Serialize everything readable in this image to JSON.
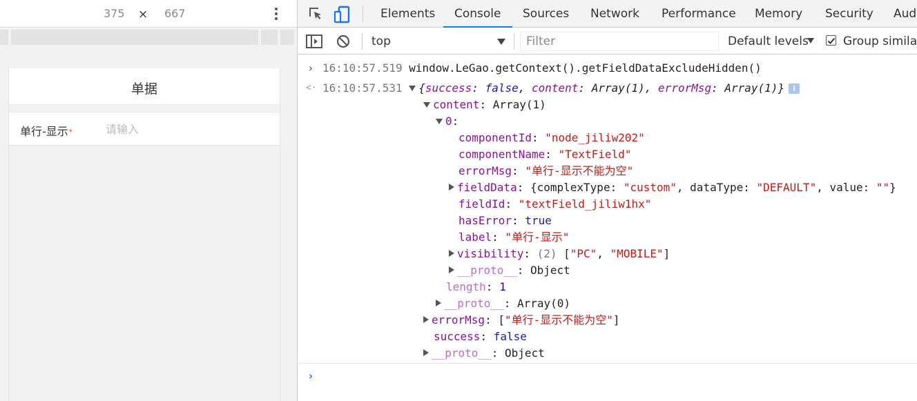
{
  "device_toolbar": {
    "width": "375",
    "times": "×",
    "height": "667"
  },
  "phone": {
    "title": "单据",
    "field_label": "单行-显示",
    "required_mark": "*",
    "placeholder": "请输入"
  },
  "devtools": {
    "tabs": [
      "Elements",
      "Console",
      "Sources",
      "Network",
      "Performance",
      "Memory",
      "Security",
      "Audi"
    ],
    "active_tab": "Console",
    "context": "top",
    "filter_placeholder": "Filter",
    "levels": "Default levels",
    "group_similar": "Group similar",
    "accent_color": "#1a73e8"
  },
  "console": {
    "cmd_time": "16:10:57.519",
    "cmd": "window.LeGao.getContext().getFieldDataExcludeHidden()",
    "res_time": "16:10:57.531",
    "summary": {
      "open": "{",
      "k1": "success",
      "v1": "false",
      "k2": "content",
      "v2": "Array(1)",
      "k3": "errorMsg",
      "v3": "Array(1)",
      "close": "}"
    },
    "info": "i",
    "content": {
      "key": "content",
      "value": "Array(1)"
    },
    "index0": "0",
    "componentId": {
      "key": "componentId",
      "value": "\"node_jiliw202\""
    },
    "componentName": {
      "key": "componentName",
      "value": "\"TextField\""
    },
    "errorMsg0": {
      "key": "errorMsg",
      "value": "\"单行-显示不能为空\""
    },
    "fieldData": {
      "key": "fieldData",
      "k1": "complexType",
      "v1": "\"custom\"",
      "k2": "dataType",
      "v2": "\"DEFAULT\"",
      "k3": "value",
      "v3": "\"\""
    },
    "fieldId": {
      "key": "fieldId",
      "value": "\"textField_jiliw1hx\""
    },
    "hasError": {
      "key": "hasError",
      "value": "true"
    },
    "label": {
      "key": "label",
      "value": "\"单行-显示\""
    },
    "visibility": {
      "key": "visibility",
      "count": "(2)",
      "v1": "\"PC\"",
      "v2": "\"MOBILE\""
    },
    "proto_inner": {
      "key": "__proto__",
      "value": "Object"
    },
    "length": {
      "key": "length",
      "value": "1"
    },
    "proto_array": {
      "key": "__proto__",
      "value": "Array(0)"
    },
    "errorMsg": {
      "key": "errorMsg",
      "value": "\"单行-显示不能为空\""
    },
    "success": {
      "key": "success",
      "value": "false"
    },
    "proto_outer": {
      "key": "__proto__",
      "value": "Object"
    }
  }
}
